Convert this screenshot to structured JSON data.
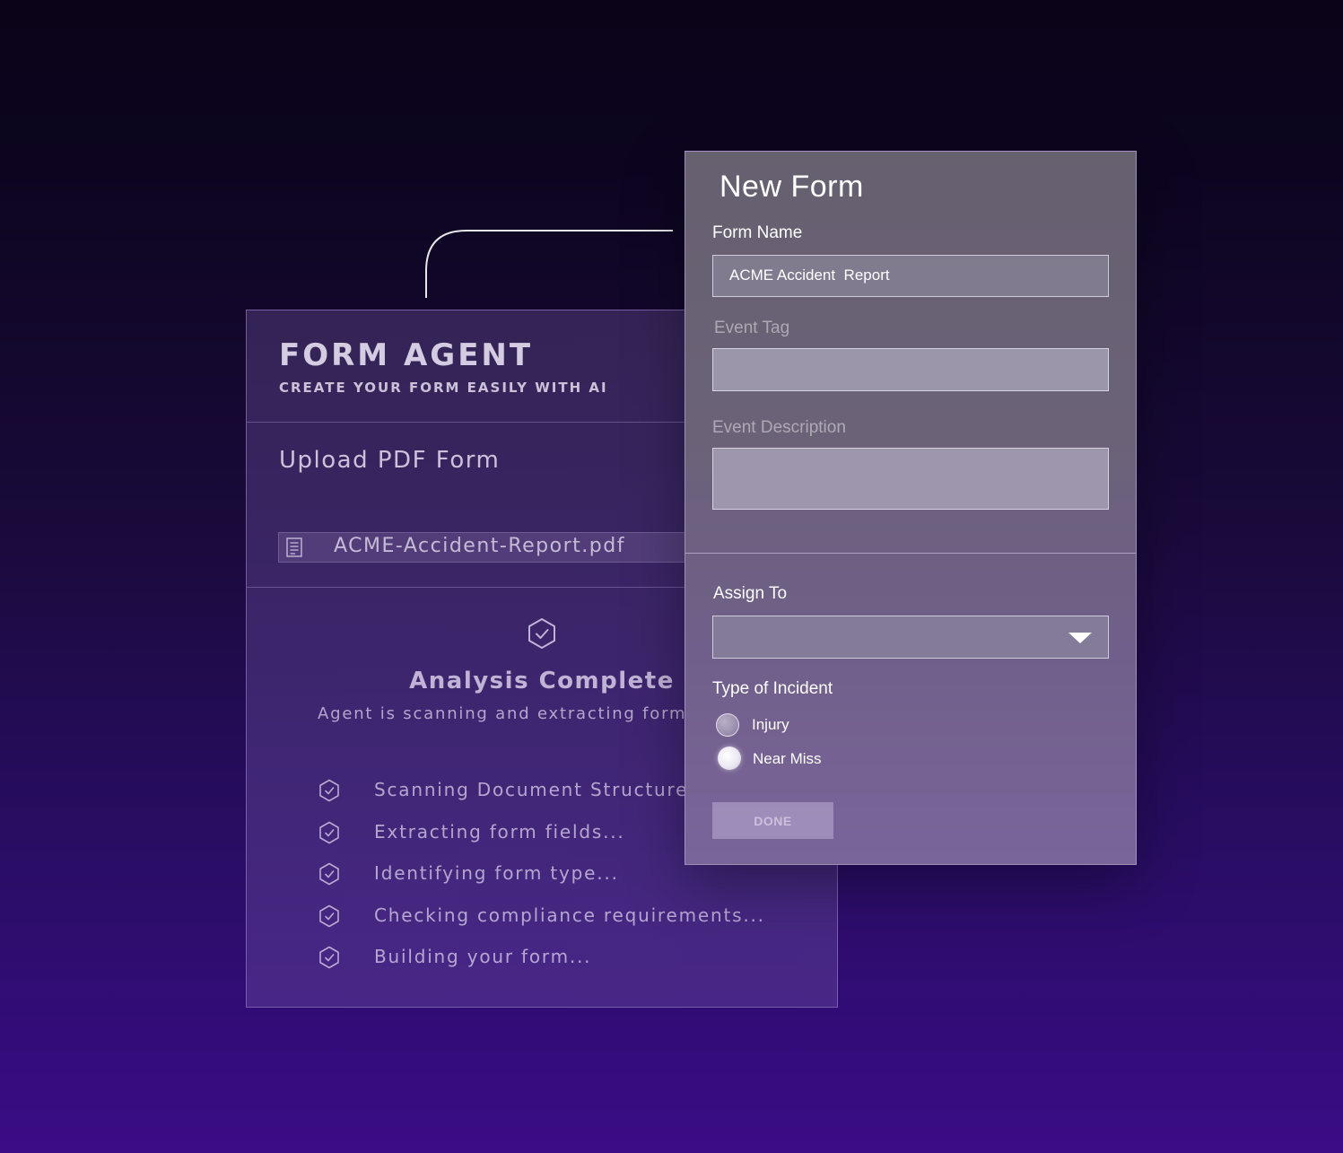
{
  "agent_panel": {
    "title": "FORM AGENT",
    "subtitle": "CREATE YOUR FORM EASILY WITH AI",
    "upload_title": "Upload PDF Form",
    "file_name": "ACME-Accident-Report.pdf",
    "analysis_title": "Analysis Complete",
    "analysis_subtitle": "Agent is scanning and extracting form s",
    "steps": [
      {
        "label": "Scanning Document Structure",
        "icon": "check-hexagon-icon"
      },
      {
        "label": "Extracting form fields...",
        "icon": "check-hexagon-icon"
      },
      {
        "label": "Identifying form type...",
        "icon": "check-hexagon-icon"
      },
      {
        "label": "Checking compliance requirements...",
        "icon": "check-hexagon-icon"
      },
      {
        "label": "Building your form...",
        "icon": "check-hexagon-icon"
      }
    ]
  },
  "form_panel": {
    "title": "New Form",
    "form_name_label": "Form Name",
    "form_name_value": "ACME Accident  Report",
    "event_tag_label": "Event Tag",
    "event_tag_value": "",
    "event_description_label": "Event Description",
    "event_description_value": "",
    "assign_to_label": "Assign To",
    "assign_to_value": "",
    "incident_type_label": "Type of Incident",
    "incident_options": [
      {
        "label": "Injury",
        "selected": false
      },
      {
        "label": "Near Miss",
        "selected": true
      }
    ],
    "done_label": "DONE"
  },
  "colors": {
    "background_top": "#0b0418",
    "background_bottom": "#3a0c86",
    "form_panel": "#6b6278",
    "agent_panel": "#4f3a7a"
  }
}
